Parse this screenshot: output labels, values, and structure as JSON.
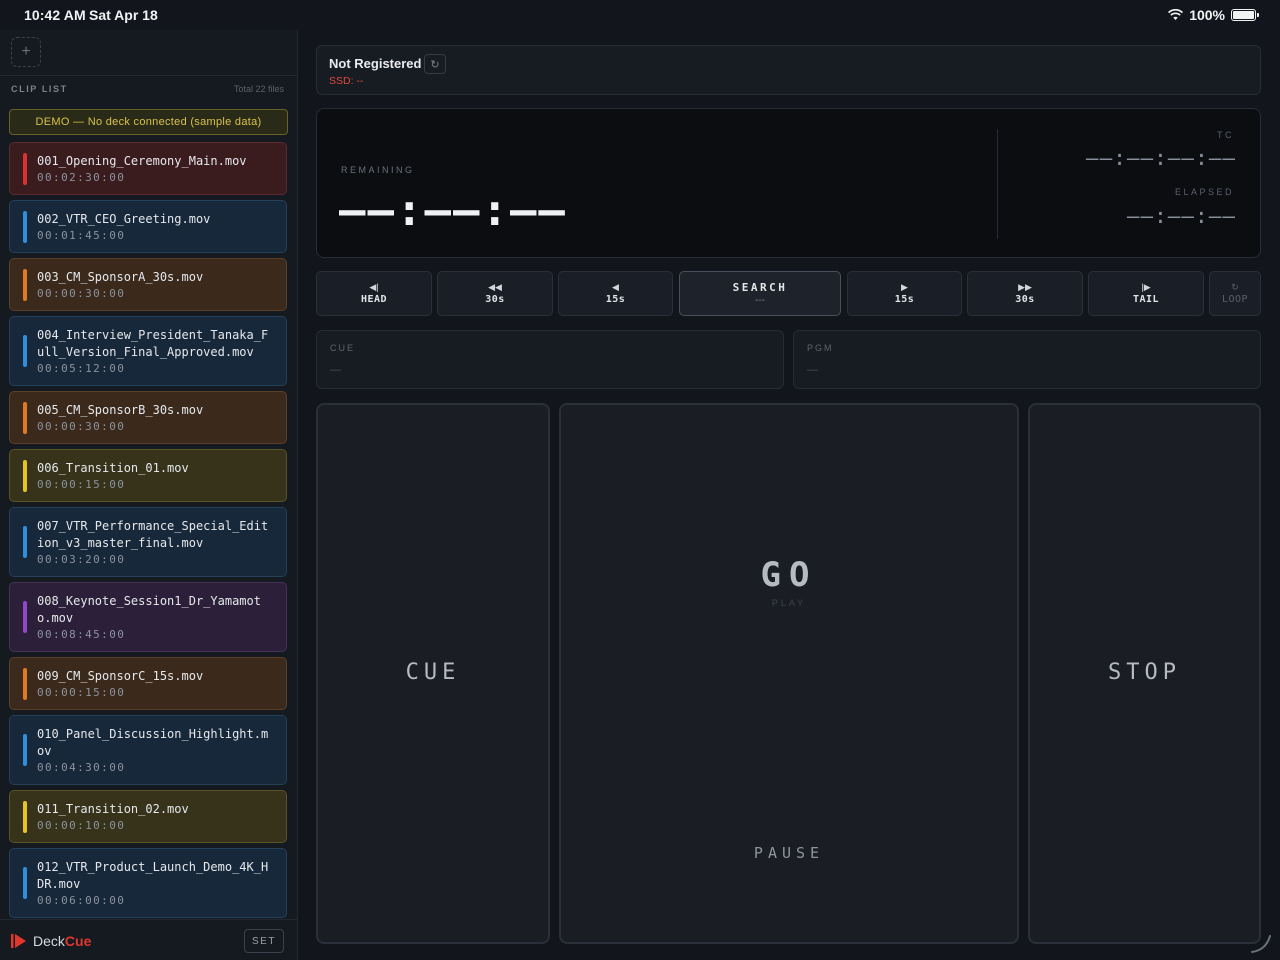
{
  "status_bar": {
    "time": "10:42 AM",
    "date": "Sat Apr 18",
    "battery": "100%"
  },
  "sidebar": {
    "add_icon": "+",
    "clip_list_title": "CLIP LIST",
    "total": "Total 22 files",
    "demo_banner": "DEMO — No deck connected (sample data)",
    "clips": [
      {
        "name": "001_Opening_Ceremony_Main.mov",
        "duration": "00:02:30:00",
        "color": "#d8332f"
      },
      {
        "name": "002_VTR_CEO_Greeting.mov",
        "duration": "00:01:45:00",
        "color": "#2f8fd8"
      },
      {
        "name": "003_CM_SponsorA_30s.mov",
        "duration": "00:00:30:00",
        "color": "#e07a22"
      },
      {
        "name": "004_Interview_President_Tanaka_Full_Version_Final_Approved.mov",
        "duration": "00:05:12:00",
        "color": "#2f8fd8"
      },
      {
        "name": "005_CM_SponsorB_30s.mov",
        "duration": "00:00:30:00",
        "color": "#e07a22"
      },
      {
        "name": "006_Transition_01.mov",
        "duration": "00:00:15:00",
        "color": "#e6c422"
      },
      {
        "name": "007_VTR_Performance_Special_Edition_v3_master_final.mov",
        "duration": "00:03:20:00",
        "color": "#2f8fd8"
      },
      {
        "name": "008_Keynote_Session1_Dr_Yamamoto.mov",
        "duration": "00:08:45:00",
        "color": "#9048c8"
      },
      {
        "name": "009_CM_SponsorC_15s.mov",
        "duration": "00:00:15:00",
        "color": "#e07a22"
      },
      {
        "name": "010_Panel_Discussion_Highlight.mov",
        "duration": "00:04:30:00",
        "color": "#2f8fd8"
      },
      {
        "name": "011_Transition_02.mov",
        "duration": "00:00:10:00",
        "color": "#e6c422"
      },
      {
        "name": "012_VTR_Product_Launch_Demo_4K_HDR.mov",
        "duration": "00:06:00:00",
        "color": "#2f8fd8"
      }
    ],
    "footer": {
      "logo_deck": "Deck",
      "logo_cue": "Cue",
      "set_label": "SET"
    }
  },
  "device": {
    "name": "Not Registered",
    "ssd": "SSD: --",
    "refresh_icon": "↻"
  },
  "timecode": {
    "remaining_label": "REMAINING",
    "remaining_value": "——:——:——",
    "tc_label": "TC",
    "tc_value": "——:——:——:——",
    "elapsed_label": "ELAPSED",
    "elapsed_value": "——:——:——"
  },
  "transport": {
    "head": {
      "icon": "◀|",
      "label": "HEAD"
    },
    "back30": {
      "icon": "◀◀",
      "label": "30s"
    },
    "back15": {
      "icon": "◀",
      "label": "15s"
    },
    "search": {
      "label": "SEARCH",
      "sub": "---"
    },
    "fwd15": {
      "icon": "▶",
      "label": "15s"
    },
    "fwd30": {
      "icon": "▶▶",
      "label": "30s"
    },
    "tail": {
      "icon": "|▶",
      "label": "TAIL"
    },
    "loop": {
      "icon": "↻",
      "label": "LOOP"
    }
  },
  "slots": {
    "cue": {
      "label": "CUE",
      "value": "—"
    },
    "pgm": {
      "label": "PGM",
      "value": "—"
    }
  },
  "controls": {
    "cue_label": "CUE",
    "go_label": "GO",
    "play_label": "PLAY",
    "pause_label": "PAUSE",
    "stop_label": "STOP"
  },
  "colors": {
    "accent_red": "#e0372d",
    "demo_yellow": "#d8c24a"
  }
}
